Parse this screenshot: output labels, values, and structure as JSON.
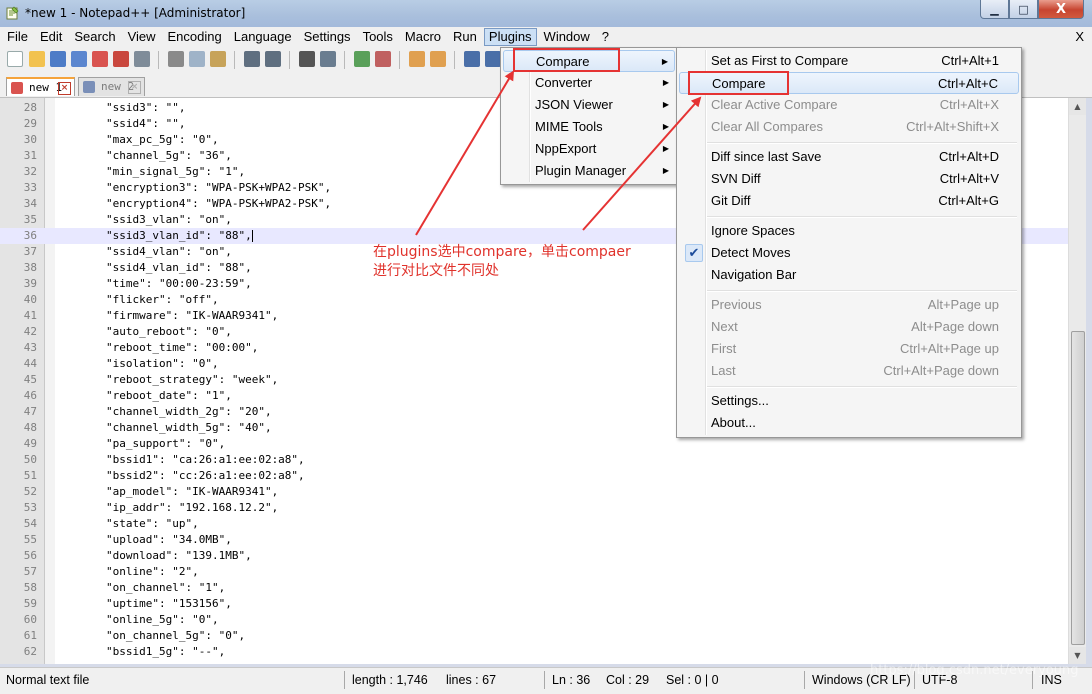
{
  "window": {
    "title": "*new 1 - Notepad++ [Administrator]",
    "min_glyph": "▁",
    "max_glyph": "□",
    "close_glyph": "X"
  },
  "menubar": {
    "items": [
      "File",
      "Edit",
      "Search",
      "View",
      "Encoding",
      "Language",
      "Settings",
      "Tools",
      "Macro",
      "Run",
      "Plugins",
      "Window",
      "?"
    ],
    "close_glyph": "X"
  },
  "tabs": [
    {
      "label": "new 1",
      "active": true
    },
    {
      "label": "new 2",
      "active": false
    }
  ],
  "editor": {
    "lines": [
      {
        "n": "28",
        "text": "\"ssid3\": \"\","
      },
      {
        "n": "29",
        "text": "\"ssid4\": \"\","
      },
      {
        "n": "30",
        "text": "\"max_pc_5g\": \"0\","
      },
      {
        "n": "31",
        "text": "\"channel_5g\": \"36\","
      },
      {
        "n": "32",
        "text": "\"min_signal_5g\": \"1\","
      },
      {
        "n": "33",
        "text": "\"encryption3\": \"WPA-PSK+WPA2-PSK\","
      },
      {
        "n": "34",
        "text": "\"encryption4\": \"WPA-PSK+WPA2-PSK\","
      },
      {
        "n": "35",
        "text": "\"ssid3_vlan\": \"on\","
      },
      {
        "n": "36",
        "text": "\"ssid3_vlan_id\": \"88\","
      },
      {
        "n": "37",
        "text": "\"ssid4_vlan\": \"on\","
      },
      {
        "n": "38",
        "text": "\"ssid4_vlan_id\": \"88\","
      },
      {
        "n": "39",
        "text": "\"time\": \"00:00-23:59\","
      },
      {
        "n": "40",
        "text": "\"flicker\": \"off\","
      },
      {
        "n": "41",
        "text": "\"firmware\": \"IK-WAAR9341\","
      },
      {
        "n": "42",
        "text": "\"auto_reboot\": \"0\","
      },
      {
        "n": "43",
        "text": "\"reboot_time\": \"00:00\","
      },
      {
        "n": "44",
        "text": "\"isolation\": \"0\","
      },
      {
        "n": "45",
        "text": "\"reboot_strategy\": \"week\","
      },
      {
        "n": "46",
        "text": "\"reboot_date\": \"1\","
      },
      {
        "n": "47",
        "text": "\"channel_width_2g\": \"20\","
      },
      {
        "n": "48",
        "text": "\"channel_width_5g\": \"40\","
      },
      {
        "n": "49",
        "text": "\"pa_support\": \"0\","
      },
      {
        "n": "50",
        "text": "\"bssid1\": \"ca:26:a1:ee:02:a8\","
      },
      {
        "n": "51",
        "text": "\"bssid2\": \"cc:26:a1:ee:02:a8\","
      },
      {
        "n": "52",
        "text": "\"ap_model\": \"IK-WAAR9341\","
      },
      {
        "n": "53",
        "text": "\"ip_addr\": \"192.168.12.2\","
      },
      {
        "n": "54",
        "text": "\"state\": \"up\","
      },
      {
        "n": "55",
        "text": "\"upload\": \"34.0MB\","
      },
      {
        "n": "56",
        "text": "\"download\": \"139.1MB\","
      },
      {
        "n": "57",
        "text": "\"online\": \"2\","
      },
      {
        "n": "58",
        "text": "\"on_channel\": \"1\","
      },
      {
        "n": "59",
        "text": "\"uptime\": \"153156\","
      },
      {
        "n": "60",
        "text": "\"online_5g\": \"0\","
      },
      {
        "n": "61",
        "text": "\"on_channel_5g\": \"0\","
      },
      {
        "n": "62",
        "text": "\"bssid1_5g\": \"--\","
      }
    ],
    "current_line": "36"
  },
  "plugins_menu": {
    "items": [
      {
        "label": "Compare",
        "submenu": true,
        "highlighted": true
      },
      {
        "label": "Converter",
        "submenu": true
      },
      {
        "label": "JSON Viewer",
        "submenu": true
      },
      {
        "label": "MIME Tools",
        "submenu": true
      },
      {
        "label": "NppExport",
        "submenu": true
      },
      {
        "label": "Plugin Manager",
        "submenu": true
      }
    ]
  },
  "compare_menu": {
    "items": [
      {
        "label": "Set as First to Compare",
        "shortcut": "Ctrl+Alt+1",
        "enabled": true
      },
      {
        "label": "Compare",
        "shortcut": "Ctrl+Alt+C",
        "enabled": true,
        "highlighted": true
      },
      {
        "label": "Clear Active Compare",
        "shortcut": "Ctrl+Alt+X",
        "enabled": false
      },
      {
        "label": "Clear All Compares",
        "shortcut": "Ctrl+Alt+Shift+X",
        "enabled": false
      },
      {
        "label": "Diff since last Save",
        "shortcut": "Ctrl+Alt+D",
        "enabled": true
      },
      {
        "label": "SVN Diff",
        "shortcut": "Ctrl+Alt+V",
        "enabled": true
      },
      {
        "label": "Git Diff",
        "shortcut": "Ctrl+Alt+G",
        "enabled": true
      },
      {
        "label": "Ignore Spaces",
        "shortcut": "",
        "enabled": true
      },
      {
        "label": "Detect Moves",
        "shortcut": "",
        "enabled": true,
        "checked": true
      },
      {
        "label": "Navigation Bar",
        "shortcut": "",
        "enabled": true
      },
      {
        "label": "Previous",
        "shortcut": "Alt+Page up",
        "enabled": false
      },
      {
        "label": "Next",
        "shortcut": "Alt+Page down",
        "enabled": false
      },
      {
        "label": "First",
        "shortcut": "Ctrl+Alt+Page up",
        "enabled": false
      },
      {
        "label": "Last",
        "shortcut": "Ctrl+Alt+Page down",
        "enabled": false
      },
      {
        "label": "Settings...",
        "shortcut": "",
        "enabled": true
      },
      {
        "label": "About...",
        "shortcut": "",
        "enabled": true
      }
    ]
  },
  "annotation": {
    "line1": "在plugins选中compare，单击compaer",
    "line2": "进行对比文件不同处",
    "color": "#e0322b"
  },
  "statusbar": {
    "file_type": "Normal text file",
    "length": "length : 1,746",
    "lines": "lines : 67",
    "ln": "Ln : 36",
    "col": "Col : 29",
    "sel": "Sel : 0 | 0",
    "eol": "Windows (CR LF)",
    "encoding": "UTF-8",
    "mode": "INS"
  },
  "watermark": "https://blog.csdn.net/everyoung"
}
